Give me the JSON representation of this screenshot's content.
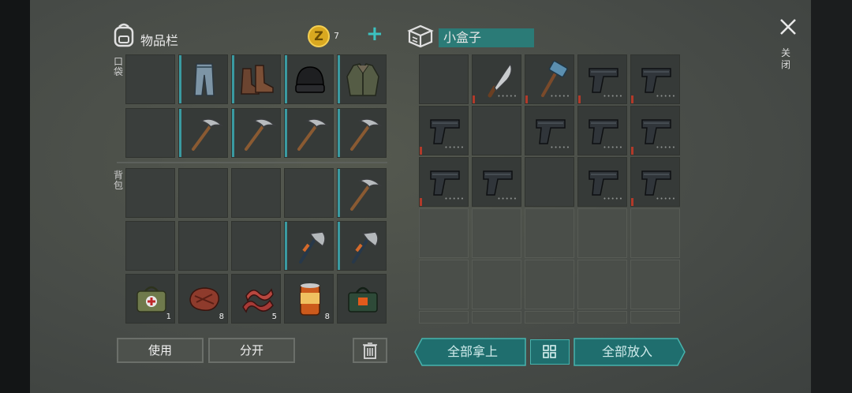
{
  "inventory": {
    "title": "物品栏",
    "coin_count": "7",
    "plus_label": "+",
    "pockets_label": "口袋",
    "backpack_label": "背包",
    "pockets_row1": [
      {
        "icon": "empty"
      },
      {
        "icon": "pants-icon",
        "bar": true
      },
      {
        "icon": "boots-icon",
        "bar": true
      },
      {
        "icon": "beanie-icon",
        "bar": true
      },
      {
        "icon": "jacket-icon",
        "bar": true
      }
    ],
    "pockets_row2": [
      {
        "icon": "empty"
      },
      {
        "icon": "pickaxe-icon",
        "bar": true
      },
      {
        "icon": "pickaxe-icon",
        "bar": true
      },
      {
        "icon": "pickaxe-icon",
        "bar": true
      },
      {
        "icon": "pickaxe-icon",
        "bar": true
      }
    ],
    "backpack_row1": [
      {
        "icon": "empty"
      },
      {
        "icon": "empty"
      },
      {
        "icon": "empty"
      },
      {
        "icon": "empty"
      },
      {
        "icon": "pickaxe-icon",
        "bar": true
      }
    ],
    "backpack_row2": [
      {
        "icon": "empty"
      },
      {
        "icon": "empty"
      },
      {
        "icon": "empty"
      },
      {
        "icon": "hatchet-icon",
        "bar": true
      },
      {
        "icon": "hatchet-icon",
        "bar": true
      }
    ],
    "backpack_row3": [
      {
        "icon": "medkit-icon",
        "qty": "1"
      },
      {
        "icon": "steak-icon",
        "qty": "8"
      },
      {
        "icon": "bacon-icon",
        "qty": "5"
      },
      {
        "icon": "canned-food-icon",
        "qty": "8"
      },
      {
        "icon": "bag-icon"
      }
    ],
    "use_button": "使用",
    "split_button": "分开"
  },
  "box": {
    "title": "小盒子",
    "close_label": "关闭",
    "row1": [
      {
        "icon": "empty"
      },
      {
        "icon": "machete-icon",
        "low": true
      },
      {
        "icon": "sledgehammer-icon",
        "low": true
      },
      {
        "icon": "pistol-icon",
        "low": true
      },
      {
        "icon": "pistol-icon",
        "low": true
      }
    ],
    "row2": [
      {
        "icon": "pistol-icon",
        "low": true
      },
      {
        "icon": "empty"
      },
      {
        "icon": "pistol-icon"
      },
      {
        "icon": "pistol-icon"
      },
      {
        "icon": "pistol-icon",
        "low": true
      }
    ],
    "row3": [
      {
        "icon": "pistol-icon",
        "low": true
      },
      {
        "icon": "pistol-icon"
      },
      {
        "icon": "empty"
      },
      {
        "icon": "pistol-icon"
      },
      {
        "icon": "pistol-icon",
        "low": true
      }
    ],
    "take_all_button": "全部拿上",
    "put_all_button": "全部放入"
  },
  "colors": {
    "accent": "#1f6e6e",
    "durability": "#3a9aa1",
    "low_durability": "#b23a2a",
    "coin": "#d9a820"
  }
}
